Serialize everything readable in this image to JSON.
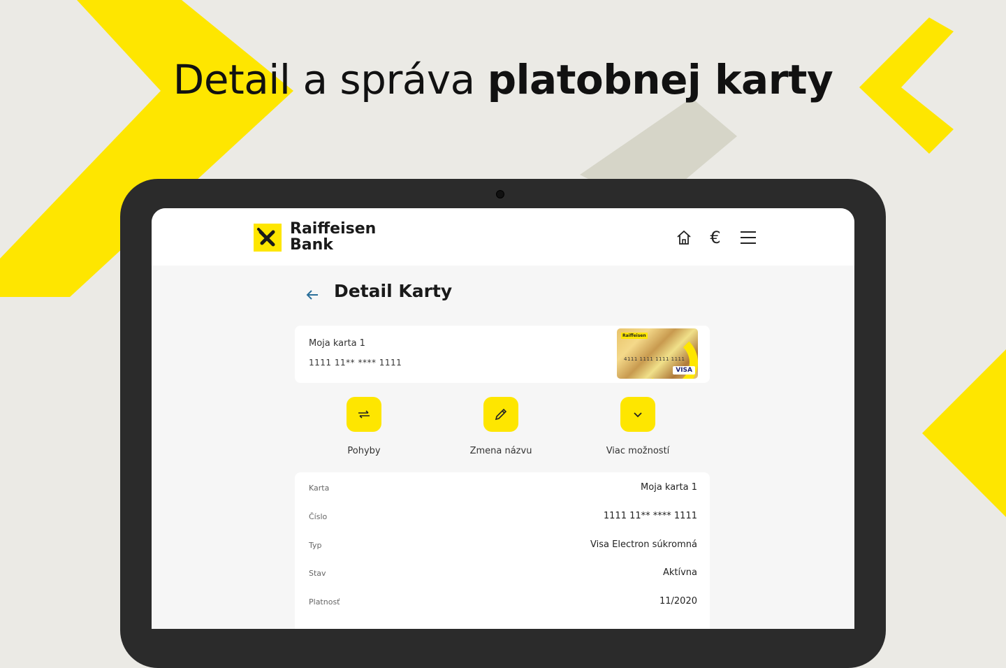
{
  "headline": {
    "light": "Detail a správa",
    "bold": "platobnej karty"
  },
  "brand": {
    "line1": "Raiffeisen",
    "line2": "Bank",
    "accent": "#fee600"
  },
  "nav": {
    "home_icon": "home-icon",
    "euro_symbol": "€",
    "menu_icon": "hamburger-menu-icon"
  },
  "page": {
    "title": "Detail Karty",
    "back_icon": "arrow-left-icon"
  },
  "card": {
    "name": "Moja karta 1",
    "number": "1111 11** **** 1111",
    "image_brand": "VISA",
    "image_digits": "4111 1111 1111 1111"
  },
  "actions": [
    {
      "label": "Pohyby",
      "icon": "transfer-arrows-icon"
    },
    {
      "label": "Zmena názvu",
      "icon": "pencil-icon"
    },
    {
      "label": "Viac možností",
      "icon": "chevron-down-icon"
    }
  ],
  "details": [
    {
      "label": "Karta",
      "value": "Moja karta 1"
    },
    {
      "label": "Číslo",
      "value": "1111 11** **** 1111"
    },
    {
      "label": "Typ",
      "value": "Visa Electron súkromná"
    },
    {
      "label": "Stav",
      "value": "Aktívna"
    },
    {
      "label": "Platnosť",
      "value": "11/2020"
    }
  ]
}
